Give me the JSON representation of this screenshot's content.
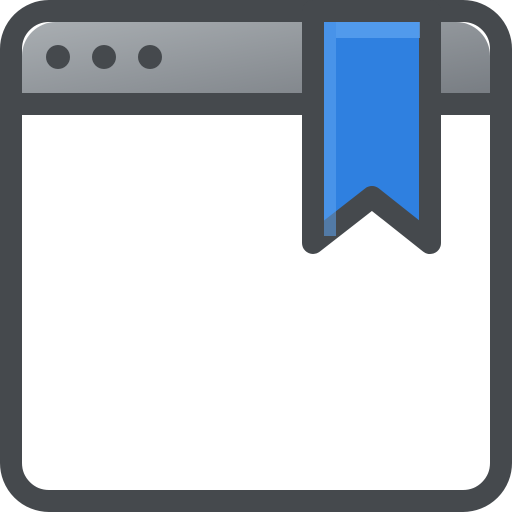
{
  "icon": {
    "name": "bookmarked-browser-window-icon",
    "colors": {
      "outline": "#45494D",
      "titlebar_dark": "#757A80",
      "titlebar_light": "#A9AEB2",
      "content": "#ffffff",
      "bookmark": "#2F80E0",
      "bookmark_highlight": "#5DA3F0"
    },
    "window_dots": [
      "dot",
      "dot",
      "dot"
    ]
  }
}
